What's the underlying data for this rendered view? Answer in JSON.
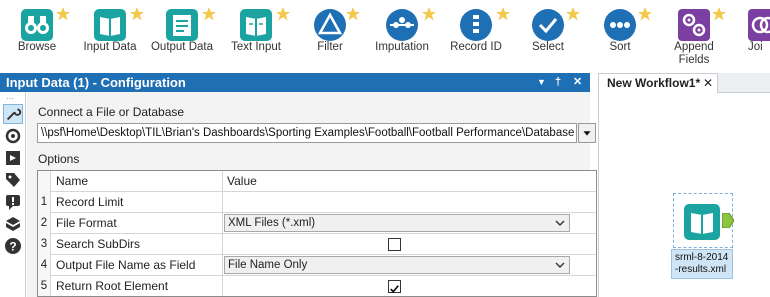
{
  "palette": {
    "tools": [
      {
        "label": "Browse",
        "icon": "browse-binoculars-icon",
        "color": "#1aa3a0"
      },
      {
        "label": "Input Data",
        "icon": "input-book-icon",
        "color": "#1aa3a0"
      },
      {
        "label": "Output Data",
        "icon": "output-book-icon",
        "color": "#1aa3a0"
      },
      {
        "label": "Text Input",
        "icon": "text-input-book-icon",
        "color": "#1aa3a0"
      },
      {
        "label": "Filter",
        "icon": "filter-triangle-icon",
        "color": "#1f6fb5"
      },
      {
        "label": "Imputation",
        "icon": "imputation-icon",
        "color": "#1f6fb5"
      },
      {
        "label": "Record ID",
        "icon": "record-id-icon",
        "color": "#1f6fb5"
      },
      {
        "label": "Select",
        "icon": "select-check-icon",
        "color": "#1f6fb5"
      },
      {
        "label": "Sort",
        "icon": "sort-dots-icon",
        "color": "#1f6fb5"
      },
      {
        "label": "Append Fields",
        "icon": "append-fields-gear-icon",
        "color": "#7a3fa0"
      },
      {
        "label": "Joi",
        "icon": "join-icon",
        "color": "#7a3fa0"
      }
    ],
    "favorite_star_color": "#f2c94c"
  },
  "config": {
    "title": "Input Data (1) - Configuration",
    "pin_glyph": "▼",
    "pushpin_glyph": "†",
    "close_glyph": "✕",
    "connect_label": "Connect a File or Database",
    "path_value": "\\\\psf\\Home\\Desktop\\TIL\\Brian's Dashboards\\Sporting Examples\\Football\\Football Performance\\Database",
    "options_label": "Options",
    "columns": {
      "name": "Name",
      "value": "Value"
    },
    "rows": [
      {
        "num": "1",
        "name": "Record Limit",
        "value": "",
        "kind": "text"
      },
      {
        "num": "2",
        "name": "File Format",
        "value": "XML Files (*.xml)",
        "kind": "select"
      },
      {
        "num": "3",
        "name": "Search SubDirs",
        "value": "",
        "kind": "checkbox",
        "checked": false
      },
      {
        "num": "4",
        "name": "Output File Name as Field",
        "value": "File Name Only",
        "kind": "select"
      },
      {
        "num": "5",
        "name": "Return Root Element",
        "value": "",
        "kind": "checkbox",
        "checked": true
      }
    ]
  },
  "workflow": {
    "tab_label": "New Workflow1*",
    "tab_close": "✕",
    "node_label": "srml-8-2014-results.xml"
  },
  "colors": {
    "title_bar": "#1f6fb5",
    "teal": "#1aa3a0",
    "connector": "#8cc63f"
  }
}
